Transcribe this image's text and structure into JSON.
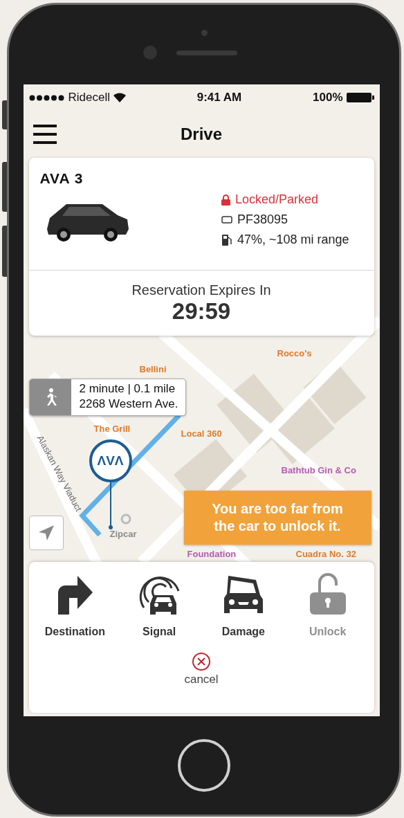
{
  "status_bar": {
    "carrier": "Ridecell",
    "time": "9:41 AM",
    "battery": "100%"
  },
  "header": {
    "title": "Drive"
  },
  "vehicle_card": {
    "name": "AVA 3",
    "status": "Locked/Parked",
    "locked": true,
    "plate": "PF38095",
    "fuel": "47%, ~108 mi range",
    "reservation_label": "Reservation Expires In",
    "timer": "29:59"
  },
  "map": {
    "labels": [
      {
        "text": "Bellini",
        "color": "#e07b2a"
      },
      {
        "text": "Rocco's",
        "color": "#e07b2a"
      },
      {
        "text": "The Grill",
        "color": "#e07b2a"
      },
      {
        "text": "Local 360",
        "color": "#e07b2a"
      },
      {
        "text": "Bathtub Gin & Co",
        "color": "#b45db0"
      },
      {
        "text": "Zipcar",
        "color": "#8a8a8a"
      },
      {
        "text": "Foundation",
        "color": "#b45db0"
      },
      {
        "text": "Cuadra No. 32",
        "color": "#e07b2a"
      },
      {
        "text": "Alaskan Way Viaduct",
        "color": "#6b6b6b"
      }
    ],
    "walk_callout": {
      "duration": "2 minute | 0.1 mile",
      "address": "2268 Western Ave."
    },
    "pin_logo": "ΛVΛ",
    "alert": "You are too far from the car to unlock it."
  },
  "actions": [
    {
      "kind": "destination",
      "label": "Destination",
      "disabled": false
    },
    {
      "kind": "signal",
      "label": "Signal",
      "disabled": false
    },
    {
      "kind": "damage",
      "label": "Damage",
      "disabled": false
    },
    {
      "kind": "unlock",
      "label": "Unlock",
      "disabled": true
    }
  ],
  "cancel": "cancel"
}
